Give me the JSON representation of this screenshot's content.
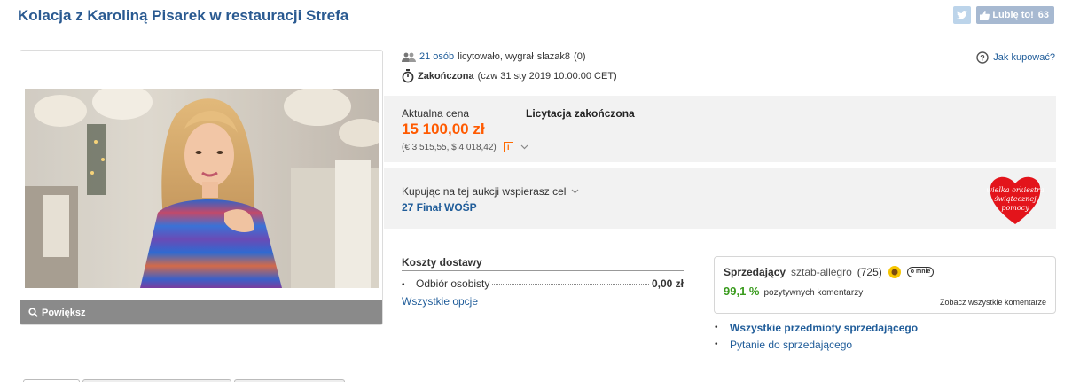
{
  "header": {
    "title": "Kolacja z Karoliną Pisarek w restauracji Strefa",
    "like_label": "Lubię to!",
    "like_count": "63"
  },
  "gallery": {
    "zoom_label": "Powiększ"
  },
  "auction": {
    "bidders_link": "21 osób",
    "bidders_text": "licytowało, wygrał",
    "winner": "slazak8",
    "winner_rating": "(0)",
    "status": "Zakończona",
    "status_date": "(czw 31 sty 2019 10:00:00 CET)",
    "how_to_buy": "Jak kupować?"
  },
  "price": {
    "label": "Aktualna cena",
    "value": "15 100,00 zł",
    "converted": "(€ 3 515,55, $ 4 018,42)",
    "auction_status": "Licytacja zakończona"
  },
  "charity": {
    "text": "Kupując na tej aukcji wspierasz cel",
    "goal": "27 Finał WOŚP",
    "logo_text": "wielka orkiestra świątecznej pomocy"
  },
  "shipping": {
    "heading": "Koszty dostawy",
    "items": [
      {
        "name": "Odbiór osobisty",
        "price": "0,00 zł"
      }
    ],
    "all_options": "Wszystkie opcje"
  },
  "seller": {
    "label": "Sprzedający",
    "name": "sztab-allegro",
    "rating": "(725)",
    "about_badge": "o mnie",
    "positive_pct": "99,1 %",
    "positive_text": "pozytywnych komentarzy",
    "all_comments": "Zobacz wszystkie komentarze",
    "links": [
      "Wszystkie przedmioty sprzedającego",
      "Pytanie do sprzedającego"
    ]
  },
  "colors": {
    "title": "#2a5a91",
    "price": "#ff5a00",
    "positive": "#3a9b1e",
    "link": "#1f5c99",
    "heart": "#e3141b"
  }
}
